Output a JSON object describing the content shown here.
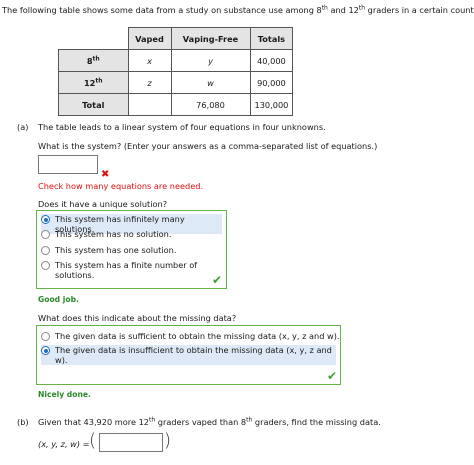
{
  "intro": {
    "pre": "The following table shows some data from a study on substance use among 8",
    "sup1": "th",
    "mid": " and 12",
    "sup2": "th",
    "post": " graders in a certain country."
  },
  "table": {
    "headers": [
      "Vaped",
      "Vaping-Free",
      "Totals"
    ],
    "rows": [
      {
        "label": "8",
        "label_sup": "th",
        "vaped": "x",
        "free": "y",
        "total": "40,000"
      },
      {
        "label": "12",
        "label_sup": "th",
        "vaped": "z",
        "free": "w",
        "total": "90,000"
      },
      {
        "label": "Total",
        "label_sup": "",
        "vaped": "",
        "free": "76,080",
        "total": "130,000"
      }
    ]
  },
  "part_a": {
    "marker": "(a)",
    "prompt": "The table leads to a linear system of four equations in four unknowns.",
    "question": "What is the system? (Enter your answers as a comma-separated list of equations.)",
    "input_value": "",
    "error_mark": "✖",
    "error_text": "Check how many equations are needed.",
    "q2": "Does it have a unique solution?",
    "q2_options": [
      "This system has infinitely many solutions.",
      "This system has no solution.",
      "This system has one solution.",
      "This system has a finite number of solutions."
    ],
    "q2_selected": 0,
    "q2_feedback": "Good job.",
    "q3": "What does this indicate about the missing data?",
    "q3_options": [
      "The given data is sufficient to obtain the missing data (x, y, z and w).",
      "The given data is insufficient to obtain the missing data (x, y, z and",
      "w)."
    ],
    "q3_selected": 1,
    "q3_feedback": "Nicely done.",
    "check_mark": "✔"
  },
  "part_b": {
    "marker": "(b)",
    "pre": "Given that 43,920 more 12",
    "sup1": "th",
    "mid": " graders vaped than 8",
    "sup2": "th",
    "post": " graders, find the missing data.",
    "answer_label": "(x, y, z, w) =",
    "lparen": "(",
    "rparen": ")",
    "input_value": ""
  }
}
